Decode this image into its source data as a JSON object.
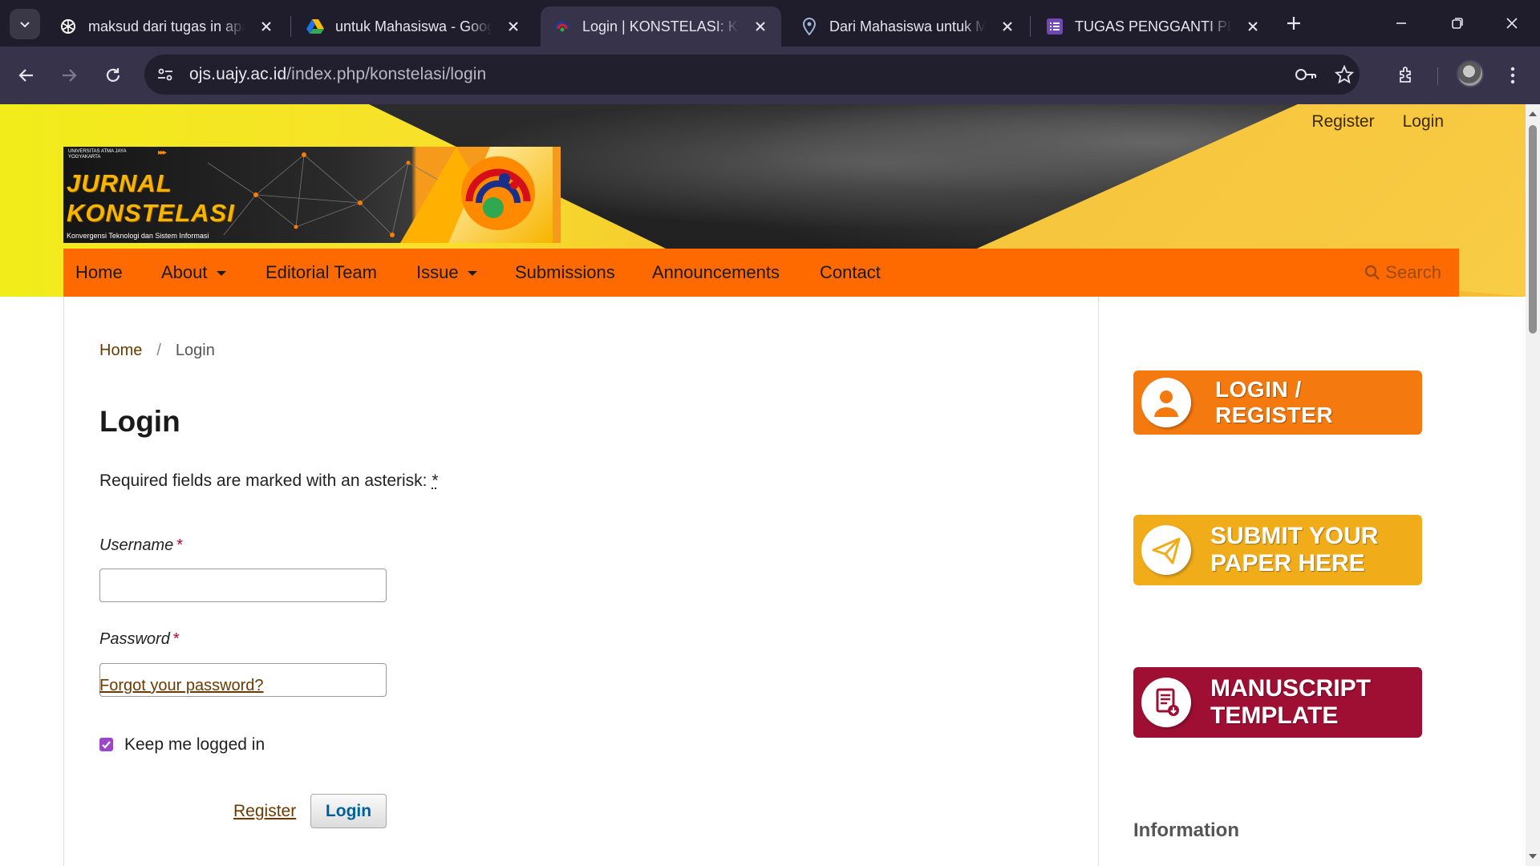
{
  "browser": {
    "tabs": [
      {
        "title": "maksud dari tugas in apa",
        "icon": "openai-icon",
        "active": false
      },
      {
        "title": "untuk Mahasiswa - Google Drive",
        "icon": "google-drive-icon",
        "active": false
      },
      {
        "title": "Login | KONSTELASI: Konvergensi",
        "icon": "konstelasi-icon",
        "active": true
      },
      {
        "title": "Dari Mahasiswa untuk Mahasiswa",
        "icon": "maps-pin-icon",
        "active": false
      },
      {
        "title": "TUGAS PENGGANTI PERTEMUAN",
        "icon": "google-forms-icon",
        "active": false
      }
    ],
    "url_host": "ojs.uajy.ac.id",
    "url_path": "/index.php/konstelasi/login",
    "colors": {
      "tabbar": "#1f1d2b",
      "toolbar": "#36334a",
      "omnibox": "#211f2d"
    }
  },
  "header": {
    "top_links": {
      "register": "Register",
      "login": "Login"
    },
    "logo": {
      "university": "UNIVERSITAS ATMA JAYA YOGYAKARTA",
      "arrows": "▸▸▸",
      "title_line1": "JURNAL",
      "title_line2": "KONSTELASI",
      "tagline": "Konvergensi Teknologi dan Sistem Informasi"
    },
    "nav": {
      "home": "Home",
      "about": "About",
      "editorial": "Editorial Team",
      "issue": "Issue",
      "submissions": "Submissions",
      "announcements": "Announcements",
      "contact": "Contact",
      "search": "Search"
    },
    "colors": {
      "nav_bg": "#ff6a00",
      "accent_yellow": "#f5bd35"
    }
  },
  "main": {
    "breadcrumb": {
      "home": "Home",
      "separator": "/",
      "current": "Login"
    },
    "title": "Login",
    "required_note": "Required fields are marked with an asterisk:",
    "asterisk": "*",
    "form": {
      "username_label": "Username",
      "username_value": "",
      "password_label": "Password",
      "password_value": "",
      "required_mark": "*",
      "forgot": "Forgot your password?",
      "keep_logged_in": "Keep me logged in",
      "keep_checked": true,
      "register": "Register",
      "login": "Login"
    }
  },
  "sidebar": {
    "login_register": "LOGIN / REGISTER",
    "submit_line1": "SUBMIT YOUR",
    "submit_line2": "PAPER HERE",
    "template_line1": "MANUSCRIPT",
    "template_line2": "TEMPLATE",
    "information": "Information",
    "colors": {
      "login": "#f47a10",
      "submit": "#f1ac1a",
      "template": "#9e0f33"
    }
  }
}
